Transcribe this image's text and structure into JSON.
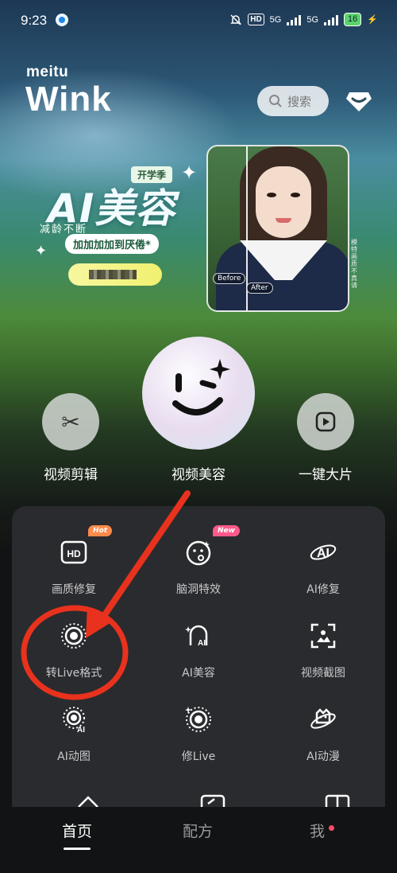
{
  "status_bar": {
    "time": "9:23",
    "hd_label": "HD",
    "network_1": "5G",
    "network_2": "5G",
    "battery": "16"
  },
  "header": {
    "logo_small": "meitu",
    "logo_big": "Wink",
    "search_placeholder": "搜索",
    "vip_icon": "diamond-icon"
  },
  "banner": {
    "season_tag": "开学季",
    "title": "AI美容",
    "subtitle": "减龄不断",
    "promo": "加加加加到厌倦*",
    "before_label": "Before",
    "after_label": "After",
    "side_note": "模特 画质不真请"
  },
  "actions": [
    {
      "label": "视频剪辑",
      "icon": "scissors-icon"
    },
    {
      "label": "视频美容",
      "icon": "smile-sparkle-icon"
    },
    {
      "label": "一键大片",
      "icon": "play-icon"
    }
  ],
  "features": [
    {
      "label": "画质修复",
      "icon": "hd-icon",
      "badge": "Hot"
    },
    {
      "label": "脑洞特效",
      "icon": "face-effect-icon",
      "badge": "New"
    },
    {
      "label": "AI修复",
      "icon": "ai-repair-icon",
      "badge": ""
    },
    {
      "label": "转Live格式",
      "icon": "live-icon",
      "badge": ""
    },
    {
      "label": "AI美容",
      "icon": "ai-beauty-icon",
      "badge": ""
    },
    {
      "label": "视频截图",
      "icon": "screenshot-icon",
      "badge": ""
    },
    {
      "label": "AI动图",
      "icon": "ai-live-icon",
      "badge": ""
    },
    {
      "label": "修Live",
      "icon": "edit-live-icon",
      "badge": ""
    },
    {
      "label": "AI动漫",
      "icon": "ai-anime-icon",
      "badge": ""
    }
  ],
  "tabs": [
    {
      "label": "首页",
      "active": true
    },
    {
      "label": "配方",
      "active": false
    },
    {
      "label": "我",
      "active": false
    }
  ],
  "colors": {
    "panel": "#2a2b2e",
    "hot_badge": "#ff8a4a",
    "new_badge": "#ff5a8a",
    "annotation": "#e8321e"
  }
}
